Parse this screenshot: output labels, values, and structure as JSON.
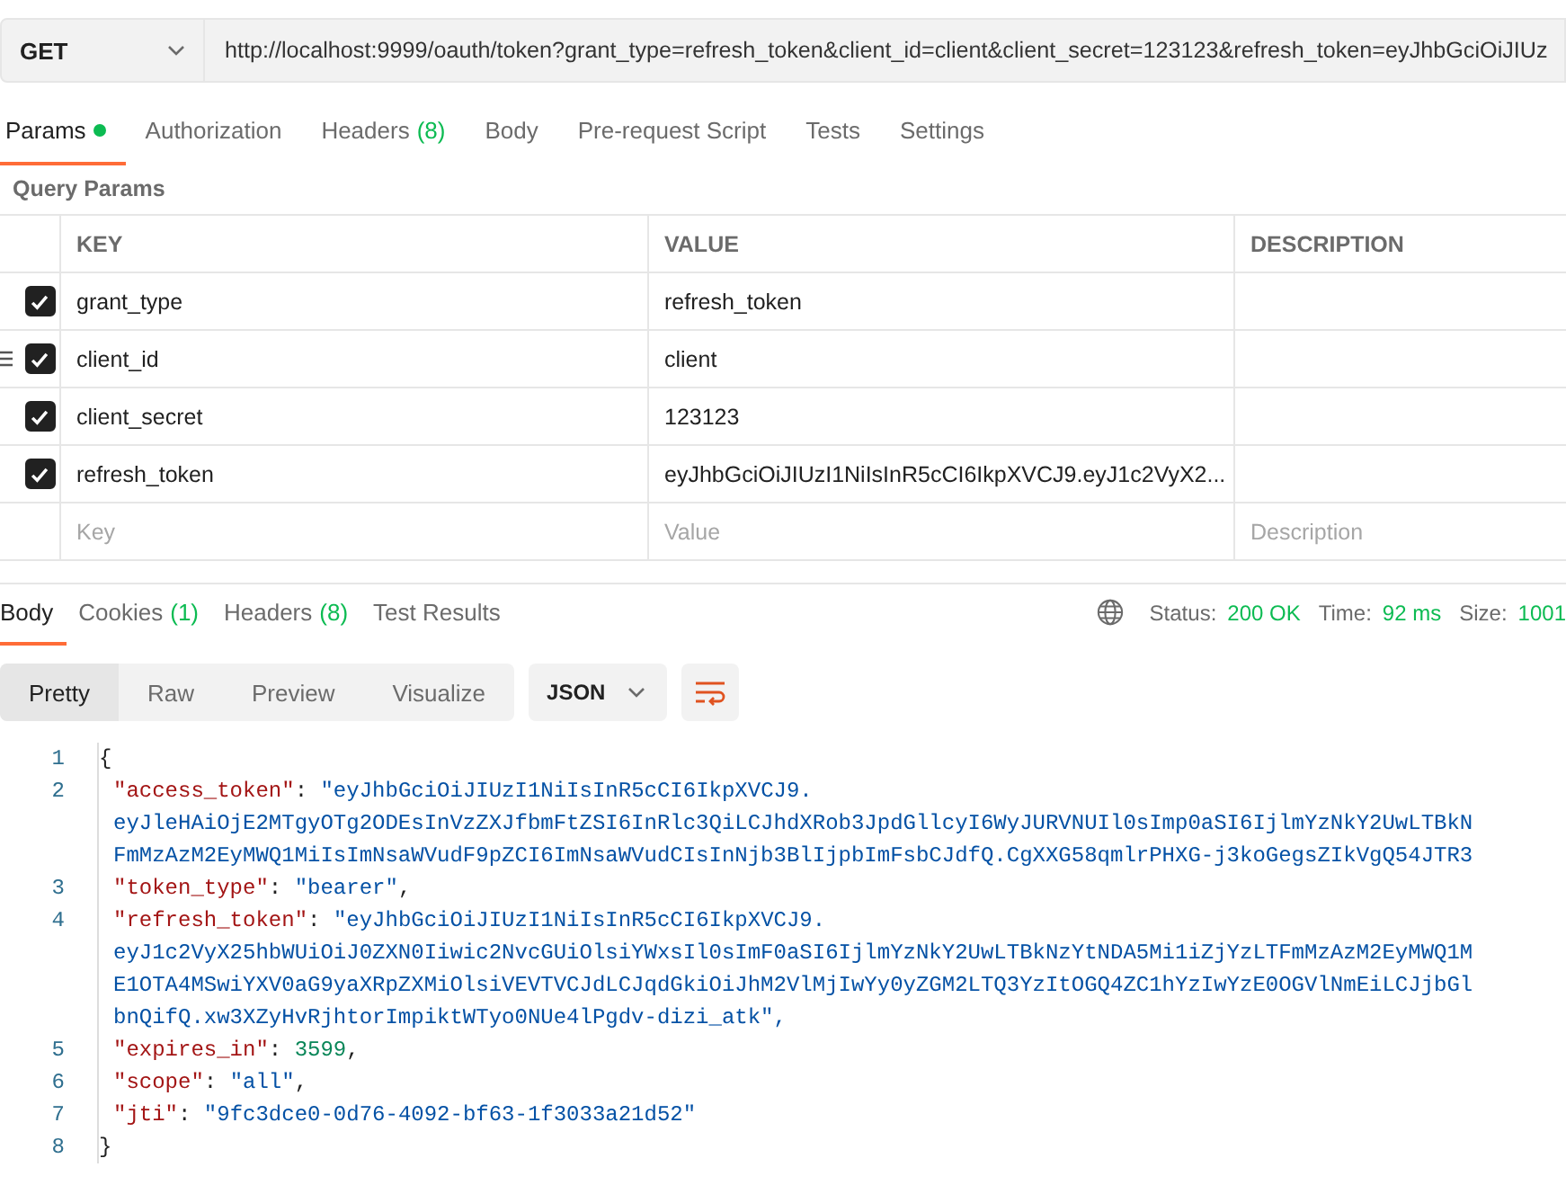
{
  "request": {
    "method": "GET",
    "url": "http://localhost:9999/oauth/token?grant_type=refresh_token&client_id=client&client_secret=123123&refresh_token=eyJhbGciOiJIUz"
  },
  "request_tabs": [
    {
      "label": "Params",
      "dot": true,
      "selected": true
    },
    {
      "label": "Authorization",
      "dot": false,
      "selected": false
    },
    {
      "label": "Headers",
      "count": "(8)",
      "dot": false,
      "selected": false
    },
    {
      "label": "Body",
      "dot": false,
      "selected": false
    },
    {
      "label": "Pre-request Script",
      "dot": false,
      "selected": false
    },
    {
      "label": "Tests",
      "dot": false,
      "selected": false
    },
    {
      "label": "Settings",
      "dot": false,
      "selected": false
    }
  ],
  "query_params": {
    "title": "Query Params",
    "columns": [
      "KEY",
      "VALUE",
      "DESCRIPTION"
    ],
    "rows": [
      {
        "key": "grant_type",
        "value": "refresh_token",
        "checked": true,
        "hovered": false
      },
      {
        "key": "client_id",
        "value": "client",
        "checked": true,
        "hovered": true
      },
      {
        "key": "client_secret",
        "value": "123123",
        "checked": true,
        "hovered": false
      },
      {
        "key": "refresh_token",
        "value": "eyJhbGciOiJIUzI1NiIsInR5cCI6IkpXVCJ9.eyJ1c2VyX2...",
        "checked": true,
        "hovered": false
      }
    ],
    "placeholders": [
      "Key",
      "Value",
      "Description"
    ]
  },
  "response_tabs": [
    {
      "label": "Body",
      "selected": true
    },
    {
      "label": "Cookies",
      "count": "(1)",
      "selected": false
    },
    {
      "label": "Headers",
      "count": "(8)",
      "selected": false
    },
    {
      "label": "Test Results",
      "selected": false
    }
  ],
  "status": [
    {
      "label": "Status:",
      "value": "200 OK"
    },
    {
      "label": "Time:",
      "value": "92 ms"
    },
    {
      "label": "Size:",
      "value": "1001"
    }
  ],
  "view_modes": [
    {
      "label": "Pretty",
      "selected": true
    },
    {
      "label": "Raw",
      "selected": false
    },
    {
      "label": "Preview",
      "selected": false
    },
    {
      "label": "Visualize",
      "selected": false
    }
  ],
  "format": "JSON",
  "code": [
    {
      "number": "1",
      "tokens": [
        {
          "kind": "brace",
          "text": "{"
        }
      ]
    },
    {
      "number": "2",
      "tokens": [
        {
          "kind": "key",
          "text": "\"access_token\""
        },
        {
          "kind": "punct",
          "text": ": "
        },
        {
          "kind": "string",
          "text": "\"eyJhbGciOiJIUzI1NiIsInR5cCI6IkpXVCJ9."
        }
      ],
      "wrapped": [
        {
          "kind": "string",
          "text": "eyJleHAiOjE2MTgyOTg2ODEsInVzZXJfbmFtZSI6InRlc3QiLCJhdXRob3JpdGllcyI6WyJURVNUIl0sImp0aSI6IjlmYzNkY2UwLTBkN"
        },
        {
          "kind": "string",
          "text": "FmMzAzM2EyMWQ1MiIsImNsaWVudF9pZCI6ImNsaWVudCIsInNjb3BlIjpbImFsbCJdfQ.CgXXG58qmlrPHXG-j3koGegsZIkVgQ54JTR3"
        }
      ]
    },
    {
      "number": "3",
      "tokens": [
        {
          "kind": "key",
          "text": "\"token_type\""
        },
        {
          "kind": "punct",
          "text": ": "
        },
        {
          "kind": "string",
          "text": "\"bearer\""
        },
        {
          "kind": "punct",
          "text": ","
        }
      ]
    },
    {
      "number": "4",
      "tokens": [
        {
          "kind": "key",
          "text": "\"refresh_token\""
        },
        {
          "kind": "punct",
          "text": ": "
        },
        {
          "kind": "string",
          "text": "\"eyJhbGciOiJIUzI1NiIsInR5cCI6IkpXVCJ9."
        }
      ],
      "wrapped": [
        {
          "kind": "string",
          "text": "eyJ1c2VyX25hbWUiOiJ0ZXN0Iiwic2NvcGUiOlsiYWxsIl0sImF0aSI6IjlmYzNkY2UwLTBkNzYtNDA5Mi1iZjYzLTFmMzAzM2EyMWQ1M"
        },
        {
          "kind": "string",
          "text": "E1OTA4MSwiYXV0aG9yaXRpZXMiOlsiVEVTVCJdLCJqdGkiOiJhM2VlMjIwYy0yZGM2LTQ3YzItOGQ4ZC1hYzIwYzE0OGVlNmEiLCJjbGl"
        },
        {
          "kind": "string",
          "text": "bnQifQ.xw3XZyHvRjhtorImpiktWTyo0NUe4lPgdv-dizi_atk\","
        }
      ]
    },
    {
      "number": "5",
      "tokens": [
        {
          "kind": "key",
          "text": "\"expires_in\""
        },
        {
          "kind": "punct",
          "text": ": "
        },
        {
          "kind": "number",
          "text": "3599"
        },
        {
          "kind": "punct",
          "text": ","
        }
      ]
    },
    {
      "number": "6",
      "tokens": [
        {
          "kind": "key",
          "text": "\"scope\""
        },
        {
          "kind": "punct",
          "text": ": "
        },
        {
          "kind": "string",
          "text": "\"all\""
        },
        {
          "kind": "punct",
          "text": ","
        }
      ]
    },
    {
      "number": "7",
      "tokens": [
        {
          "kind": "key",
          "text": "\"jti\""
        },
        {
          "kind": "punct",
          "text": ": "
        },
        {
          "kind": "string",
          "text": "\"9fc3dce0-0d76-4092-bf63-1f3033a21d52\""
        }
      ]
    },
    {
      "number": "8",
      "tokens": [
        {
          "kind": "brace",
          "text": "}"
        }
      ]
    }
  ]
}
